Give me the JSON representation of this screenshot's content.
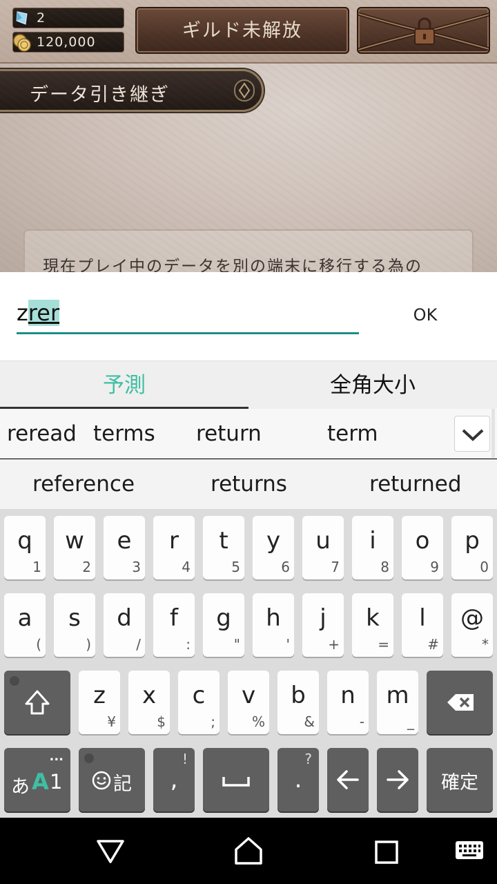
{
  "game": {
    "gem_count": "2",
    "coin_count": "120,000",
    "guild_button": "ギルド未解放",
    "page_title": "データ引き継ぎ",
    "info_text": "現在プレイ中のデータを別の端末に移行する為の"
  },
  "dialog": {
    "input_prefix": "z",
    "input_composing": "rer",
    "ok_label": "OK"
  },
  "ime_tabs": {
    "predict_label": "予測",
    "fullwidth_label": "全角大小"
  },
  "suggestions": {
    "row1": [
      "reread",
      "terms",
      "return",
      "term"
    ],
    "row2": [
      "reference",
      "returns",
      "returned"
    ]
  },
  "keyboard": {
    "row1": [
      {
        "main": "q",
        "sub": "1"
      },
      {
        "main": "w",
        "sub": "2"
      },
      {
        "main": "e",
        "sub": "3"
      },
      {
        "main": "r",
        "sub": "4"
      },
      {
        "main": "t",
        "sub": "5"
      },
      {
        "main": "y",
        "sub": "6"
      },
      {
        "main": "u",
        "sub": "7"
      },
      {
        "main": "i",
        "sub": "8"
      },
      {
        "main": "o",
        "sub": "9"
      },
      {
        "main": "p",
        "sub": "0"
      }
    ],
    "row2": [
      {
        "main": "a",
        "sub": "("
      },
      {
        "main": "s",
        "sub": ")"
      },
      {
        "main": "d",
        "sub": "/"
      },
      {
        "main": "f",
        "sub": ":"
      },
      {
        "main": "g",
        "sub": "\""
      },
      {
        "main": "h",
        "sub": "'"
      },
      {
        "main": "j",
        "sub": "+"
      },
      {
        "main": "k",
        "sub": "="
      },
      {
        "main": "l",
        "sub": "#"
      },
      {
        "main": "@",
        "sub": "*"
      }
    ],
    "row3": [
      {
        "main": "z",
        "sub": "¥"
      },
      {
        "main": "x",
        "sub": "$"
      },
      {
        "main": "c",
        "sub": ";"
      },
      {
        "main": "v",
        "sub": "%"
      },
      {
        "main": "b",
        "sub": "&"
      },
      {
        "main": "n",
        "sub": "-"
      },
      {
        "main": "m",
        "sub": "_"
      }
    ],
    "mode_label_a": "あ",
    "mode_label_b": "A",
    "mode_label_c": "1",
    "mode_dots": "...",
    "emoji_label": "記",
    "comma_label": ",",
    "comma_sub": "!",
    "period_label": ".",
    "period_sub": "?",
    "confirm_label": "確定"
  },
  "colors": {
    "accent": "#3fbfa3",
    "input_underline": "#1a8f86",
    "key_dark": "#5f5f5f"
  }
}
